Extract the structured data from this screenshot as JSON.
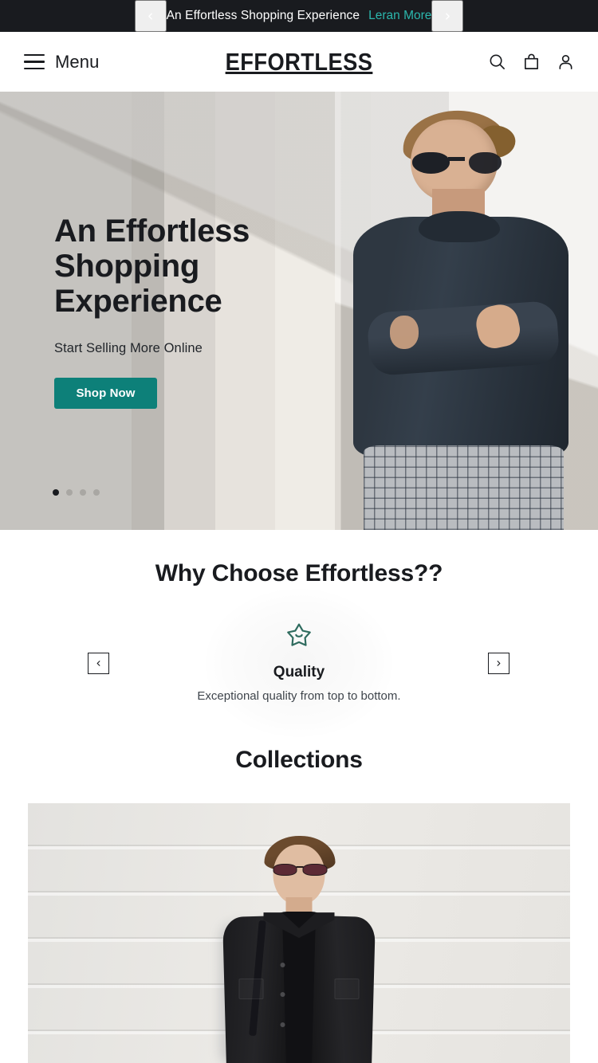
{
  "announcement": {
    "prev_icon": "chevron-left-icon",
    "next_icon": "chevron-right-icon",
    "text": "An Effortless Shopping Experience",
    "link_label": "Leran More",
    "link_color": "#2bb7ad",
    "background": "#191b1f"
  },
  "header": {
    "menu_label": "Menu",
    "menu_icon": "hamburger-icon",
    "logo": "EFFORTLESS",
    "icons": [
      {
        "name": "search-icon",
        "label": "Search"
      },
      {
        "name": "shopping-bag-icon",
        "label": "Cart"
      },
      {
        "name": "user-account-icon",
        "label": "Account"
      }
    ]
  },
  "hero": {
    "title": "An Effortless Shopping Experience",
    "subtitle": "Start Selling More Online",
    "cta_label": "Shop Now",
    "cta_color": "#0d8079",
    "slide_count": 4,
    "active_slide": 1,
    "image_alt": "Man in dark sweater and checked trousers wearing sunglasses leaning against a wall"
  },
  "features": {
    "title": "Why Choose Effortless??",
    "prev_icon": "chevron-left-icon",
    "next_icon": "chevron-right-icon",
    "items": [
      {
        "icon": "smiling-star-icon",
        "icon_color": "#2e6b5e",
        "title": "Quality",
        "description": "Exceptional quality from top to bottom."
      }
    ]
  },
  "collections": {
    "title": "Collections",
    "image_alt": "Man in black denim jacket and sunglasses standing against a light paneled wall"
  }
}
